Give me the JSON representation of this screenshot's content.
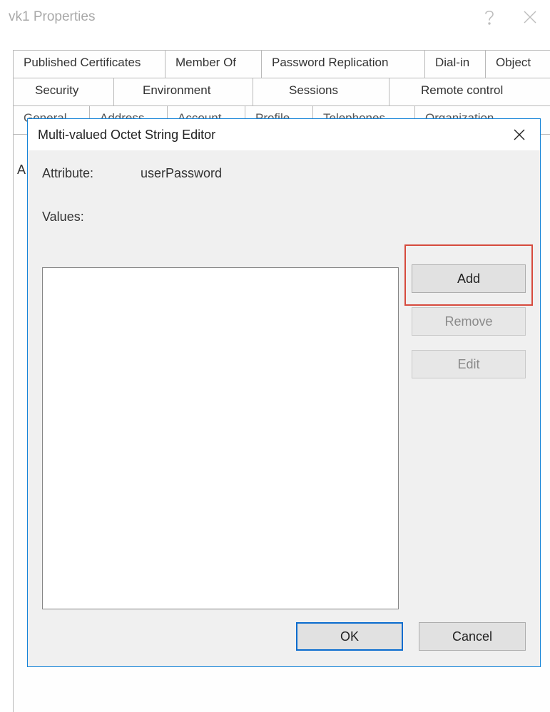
{
  "properties": {
    "title": "vk1 Properties",
    "tabs_row1": [
      "Published Certificates",
      "Member Of",
      "Password Replication",
      "Dial-in",
      "Object"
    ],
    "tabs_row2": [
      "Security",
      "Environment",
      "Sessions",
      "Remote control"
    ],
    "tabs_row3": [
      "General",
      "Address",
      "Account",
      "Profile",
      "Telephones",
      "Organization"
    ],
    "peek_char": "A"
  },
  "editor": {
    "title": "Multi-valued Octet String Editor",
    "attribute_label": "Attribute:",
    "attribute_value": "userPassword",
    "values_label": "Values:",
    "buttons": {
      "add": "Add",
      "remove": "Remove",
      "edit": "Edit",
      "ok": "OK",
      "cancel": "Cancel"
    },
    "values": []
  },
  "icons": {
    "help": "help-icon",
    "close": "close-icon"
  },
  "highlight": "add-button"
}
